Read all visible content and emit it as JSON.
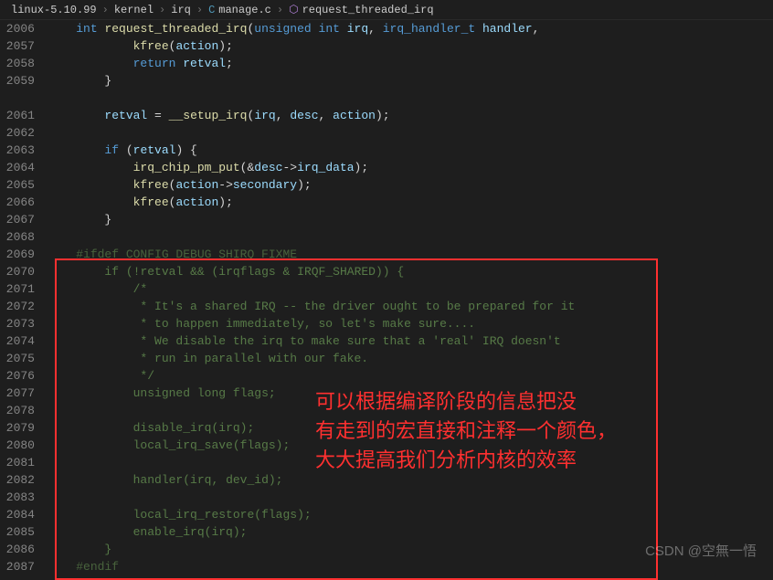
{
  "breadcrumb": {
    "items": [
      "linux-5.10.99",
      "kernel",
      "irq",
      "manage.c",
      "request_threaded_irq"
    ],
    "file_prefix": "C",
    "func_glyph": "⬡"
  },
  "annotation": "可以根据编译阶段的信息把没\n有走到的宏直接和注释一个颜色，\n大大提高我们分析内核的效率",
  "watermark": "CSDN @空無一悟",
  "lines": [
    {
      "n": "2006",
      "html": "    <span class='kw'>int</span> <span class='fn'>request_threaded_irq</span>(<span class='kw'>unsigned</span> <span class='kw'>int</span> <span class='param'>irq</span>, <span class='type'>irq_handler_t</span> <span class='param'>handler</span>,"
    },
    {
      "n": "2057",
      "html": "            <span class='fn'>kfree</span>(<span class='var'>action</span>);"
    },
    {
      "n": "2058",
      "html": "            <span class='kw'>return</span> <span class='var'>retval</span>;"
    },
    {
      "n": "2059",
      "html": "        }"
    },
    {
      "n": "",
      "html": ""
    },
    {
      "n": "2061",
      "html": "        <span class='var'>retval</span> <span class='op'>=</span> <span class='fn'>__setup_irq</span>(<span class='var'>irq</span>, <span class='var'>desc</span>, <span class='var'>action</span>);"
    },
    {
      "n": "2062",
      "html": ""
    },
    {
      "n": "2063",
      "html": "        <span class='kw'>if</span> (<span class='var'>retval</span>) {"
    },
    {
      "n": "2064",
      "html": "            <span class='fn'>irq_chip_pm_put</span>(<span class='op'>&amp;</span><span class='var'>desc</span><span class='op'>-&gt;</span><span class='var'>irq_data</span>);"
    },
    {
      "n": "2065",
      "html": "            <span class='fn'>kfree</span>(<span class='var'>action</span><span class='op'>-&gt;</span><span class='var'>secondary</span>);"
    },
    {
      "n": "2066",
      "html": "            <span class='fn'>kfree</span>(<span class='var'>action</span>);"
    },
    {
      "n": "2067",
      "html": "        }"
    },
    {
      "n": "2068",
      "html": ""
    },
    {
      "n": "2069",
      "html": "    <span class='preproc'>#ifdef CONFIG_DEBUG_SHIRQ_FIXME</span>",
      "dim": true
    },
    {
      "n": "2070",
      "html": "        <span class='kw'>if</span> (<span class='op'>!</span><span class='var'>retval</span> <span class='op'>&amp;&amp;</span> (<span class='var'>irqflags</span> <span class='op'>&amp;</span> <span class='const'>IRQF_SHARED</span>)) {",
      "dim": true
    },
    {
      "n": "2071",
      "html": "            <span class='comment'>/*</span>",
      "dim": true
    },
    {
      "n": "2072",
      "html": "            <span class='comment'> * It's a shared IRQ -- the driver ought to be prepared for it</span>",
      "dim": true
    },
    {
      "n": "2073",
      "html": "            <span class='comment'> * to happen immediately, so let's make sure....</span>",
      "dim": true
    },
    {
      "n": "2074",
      "html": "            <span class='comment'> * We disable the irq to make sure that a 'real' IRQ doesn't</span>",
      "dim": true
    },
    {
      "n": "2075",
      "html": "            <span class='comment'> * run in parallel with our fake.</span>",
      "dim": true
    },
    {
      "n": "2076",
      "html": "            <span class='comment'> */</span>",
      "dim": true
    },
    {
      "n": "2077",
      "html": "            <span class='kw'>unsigned</span> <span class='kw'>long</span> <span class='var'>flags</span>;",
      "dim": true
    },
    {
      "n": "2078",
      "html": "",
      "dim": true
    },
    {
      "n": "2079",
      "html": "            <span class='fn'>disable_irq</span>(<span class='var'>irq</span>);",
      "dim": true
    },
    {
      "n": "2080",
      "html": "            <span class='fn'>local_irq_save</span>(<span class='var'>flags</span>);",
      "dim": true
    },
    {
      "n": "2081",
      "html": "",
      "dim": true
    },
    {
      "n": "2082",
      "html": "            <span class='fn'>handler</span>(<span class='var'>irq</span>, <span class='var'>dev_id</span>);",
      "dim": true
    },
    {
      "n": "2083",
      "html": "",
      "dim": true
    },
    {
      "n": "2084",
      "html": "            <span class='fn'>local_irq_restore</span>(<span class='var'>flags</span>);",
      "dim": true
    },
    {
      "n": "2085",
      "html": "            <span class='fn'>enable_irq</span>(<span class='var'>irq</span>);",
      "dim": true
    },
    {
      "n": "2086",
      "html": "        }",
      "dim": true
    },
    {
      "n": "2087",
      "html": "    <span class='preproc'>#endif</span>",
      "dim": true
    }
  ]
}
